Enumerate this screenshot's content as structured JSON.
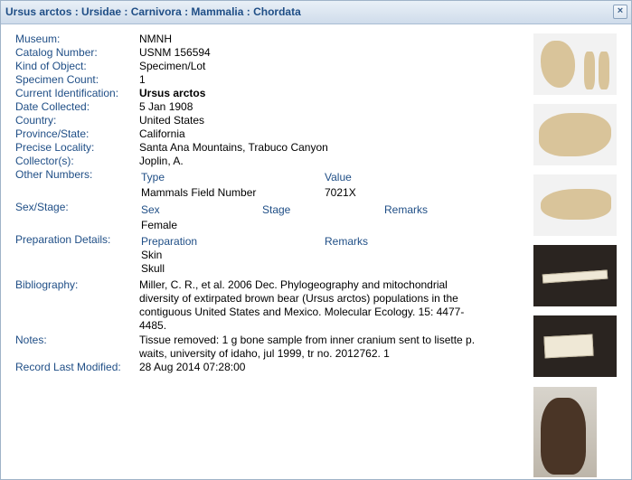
{
  "window": {
    "title": "Ursus arctos : Ursidae : Carnivora : Mammalia : Chordata",
    "close_glyph": "×"
  },
  "record": {
    "museum_label": "Museum:",
    "museum": "NMNH",
    "catalog_label": "Catalog Number:",
    "catalog": "USNM 156594",
    "kind_label": "Kind of Object:",
    "kind": "Specimen/Lot",
    "count_label": "Specimen Count:",
    "count": "1",
    "ident_label": "Current Identification:",
    "ident": "Ursus arctos",
    "date_label": "Date Collected:",
    "date": "5 Jan 1908",
    "country_label": "Country:",
    "country": "United States",
    "province_label": "Province/State:",
    "province": "California",
    "locality_label": "Precise Locality:",
    "locality": "Santa Ana Mountains, Trabuco Canyon",
    "collector_label": "Collector(s):",
    "collector": "Joplin, A.",
    "other_label": "Other Numbers:",
    "other_headers": [
      "Type",
      "Value"
    ],
    "other_values": [
      "Mammals Field Number",
      "7021X"
    ],
    "sex_label": "Sex/Stage:",
    "sex_headers": [
      "Sex",
      "Stage",
      "Remarks"
    ],
    "sex_value": "Female",
    "prep_label": "Preparation Details:",
    "prep_headers": [
      "Preparation",
      "Remarks"
    ],
    "prep_values": [
      "Skin",
      "Skull"
    ],
    "biblio_label": "Bibliography:",
    "biblio": [
      "Miller, C. R., et al. 2006 Dec. Phylogeography and mitochondrial",
      "diversity of extirpated brown bear (Ursus arctos) populations in the",
      "contiguous United States and Mexico. Molecular Ecology. 15: 4477-",
      "4485."
    ],
    "notes_label": "Notes:",
    "notes": [
      "Tissue removed: 1 g bone sample from inner cranium sent to lisette p.",
      "waits, university of idaho, jul 1999, tr no. 2012762. 1"
    ],
    "modified_label": "Record Last Modified:",
    "modified": "28 Aug 2014 07:28:00"
  },
  "colors": {
    "label": "#1f4e86",
    "title": "#1f4e86"
  }
}
